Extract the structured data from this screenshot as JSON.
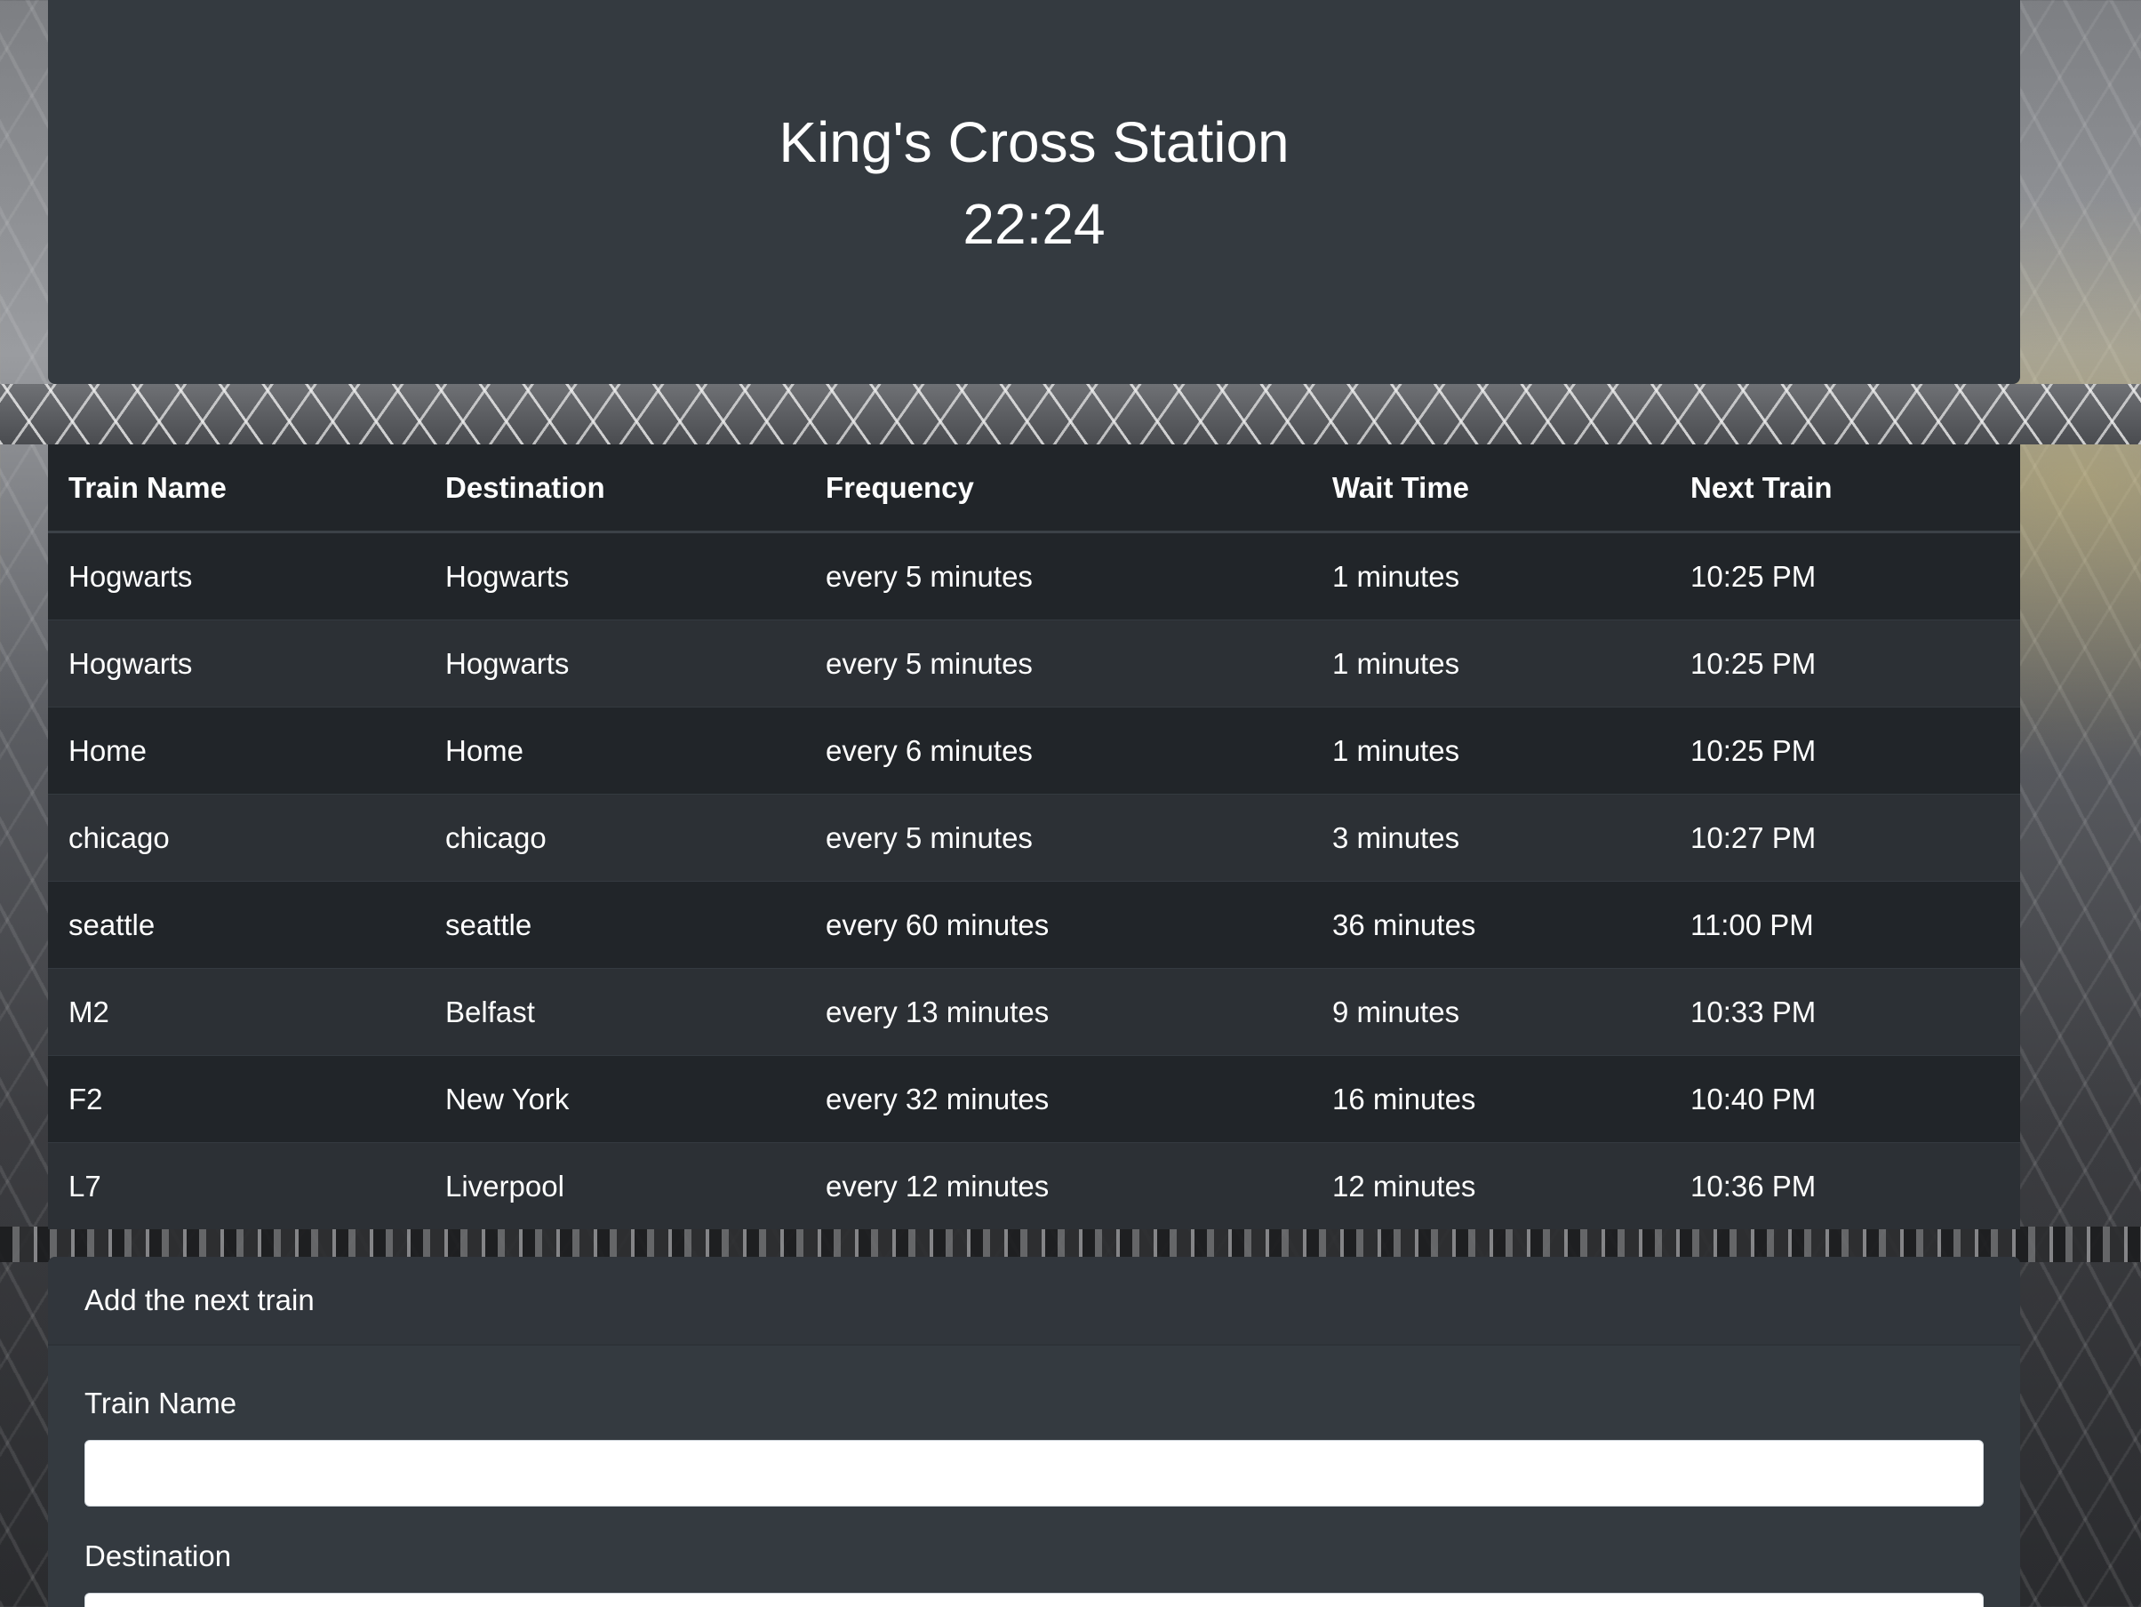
{
  "header": {
    "station_name": "King's Cross Station",
    "current_time": "22:24"
  },
  "schedule": {
    "columns": [
      "Train Name",
      "Destination",
      "Frequency",
      "Wait Time",
      "Next Train"
    ],
    "rows": [
      [
        "Hogwarts",
        "Hogwarts",
        "every 5 minutes",
        "1 minutes",
        "10:25 PM"
      ],
      [
        "Hogwarts",
        "Hogwarts",
        "every 5 minutes",
        "1 minutes",
        "10:25 PM"
      ],
      [
        "Home",
        "Home",
        "every 6 minutes",
        "1 minutes",
        "10:25 PM"
      ],
      [
        "chicago",
        "chicago",
        "every 5 minutes",
        "3 minutes",
        "10:27 PM"
      ],
      [
        "seattle",
        "seattle",
        "every 60 minutes",
        "36 minutes",
        "11:00 PM"
      ],
      [
        "M2",
        "Belfast",
        "every 13 minutes",
        "9 minutes",
        "10:33 PM"
      ],
      [
        "F2",
        "New York",
        "every 32 minutes",
        "16 minutes",
        "10:40 PM"
      ],
      [
        "L7",
        "Liverpool",
        "every 12 minutes",
        "12 minutes",
        "10:36 PM"
      ]
    ]
  },
  "form": {
    "title": "Add the next train",
    "fields": [
      {
        "label": "Train Name",
        "value": "",
        "placeholder": ""
      },
      {
        "label": "Destination",
        "value": "",
        "placeholder": ""
      }
    ]
  },
  "colors": {
    "panel": "#343a40",
    "table_dark": "#212529",
    "table_stripe": "#2c3035",
    "text": "#ffffff"
  }
}
